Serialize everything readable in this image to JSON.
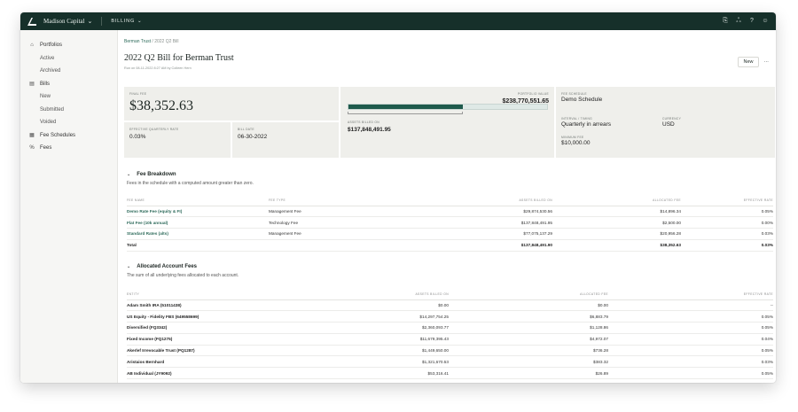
{
  "topbar": {
    "brand": "Madison Capital",
    "module": "BILLING"
  },
  "sidebar": {
    "portfolios": "Portfolios",
    "active": "Active",
    "archived": "Archived",
    "bills": "Bills",
    "new": "New",
    "submitted": "Submitted",
    "voided": "Voided",
    "fee_schedules": "Fee Schedules",
    "fees": "Fees"
  },
  "breadcrumb": {
    "parent": "Berman Trust",
    "sep": " / ",
    "current": "2022 Q2 Bill"
  },
  "page": {
    "title": "2022 Q2 Bill for Berman Trust",
    "run_on": "Run on 08-11-2022 8:27 AM by Colleen Hern",
    "new_label": "New",
    "more_label": "···"
  },
  "summary": {
    "final_fee_label": "FINAL FEE",
    "final_fee": "$38,352.63",
    "eff_rate_label": "EFFECTIVE QUARTERLY RATE",
    "eff_rate": "0.03%",
    "bill_date_label": "BILL DATE",
    "bill_date": "06-30-2022",
    "portfolio_value_label": "PORTFOLIO VALUE",
    "portfolio_value": "$238,770,551.65",
    "billed_fraction": 0.577,
    "assets_billed_label": "ASSETS BILLED ON",
    "assets_billed": "$137,848,491.95",
    "fee_schedule_label": "FEE SCHEDULE",
    "fee_schedule": "Demo Schedule",
    "interval_label": "INTERVAL / TIMING",
    "interval": "Quarterly in arrears",
    "currency_label": "CURRENCY",
    "currency": "USD",
    "min_fee_label": "MINIMUM FEE",
    "min_fee": "$10,000.00"
  },
  "fee_breakdown": {
    "title": "Fee Breakdown",
    "desc": "Fees in the schedule with a computed amount greater than zero.",
    "headers": [
      "FEE NAME",
      "FEE TYPE",
      "ASSETS BILLED ON",
      "ALLOCATED FEE",
      "EFFECTIVE RATE"
    ],
    "rows": [
      [
        "Demo Rate Fee (equity & FI)",
        "Management Fee",
        "$29,874,530.56",
        "$14,896.34",
        "0.05%"
      ],
      [
        "Flat Fee (10k annual)",
        "Technology Fee",
        "$137,848,491.95",
        "$2,500.00",
        "0.00%"
      ],
      [
        "Standard Rates (alts)",
        "Management Fee",
        "$77,075,137.29",
        "$20,956.28",
        "0.03%"
      ]
    ],
    "total": [
      "Total",
      "",
      "$137,848,491.90",
      "$38,352.63",
      "0.03%"
    ]
  },
  "account_fees": {
    "title": "Allocated Account Fees",
    "desc": "The sum of all underlying fees allocated to each account.",
    "headers": [
      "ENTITY",
      "ASSETS BILLED ON",
      "ALLOCATED FEE",
      "EFFECTIVE RATE"
    ],
    "rows": [
      [
        "Adam Smith IRA (51011438)",
        "$0.00",
        "$0.00",
        "--"
      ],
      [
        "US Equity - Fidelity FBS (649558699)",
        "$14,297,754.25",
        "$6,883.79",
        "0.05%"
      ],
      [
        "Diversified (FQ3342)",
        "$2,360,093.77",
        "$1,128.86",
        "0.05%"
      ],
      [
        "Fixed Income (FQ1275)",
        "$11,679,395.43",
        "$4,972.07",
        "0.04%"
      ],
      [
        "Akerlef Irrevocable Trust (PQ1287)",
        "$1,449,650.00",
        "$736.28",
        "0.05%"
      ],
      [
        "Aristaios Bernhard",
        "$1,321,670.53",
        "$383.32",
        "0.03%"
      ],
      [
        "AB Individual (JY9092)",
        "$53,316.41",
        "$26.89",
        "0.05%"
      ]
    ]
  },
  "colors": {
    "topbar": "#16302a",
    "accent": "#1e5a4c",
    "link": "#2d6a5a"
  }
}
